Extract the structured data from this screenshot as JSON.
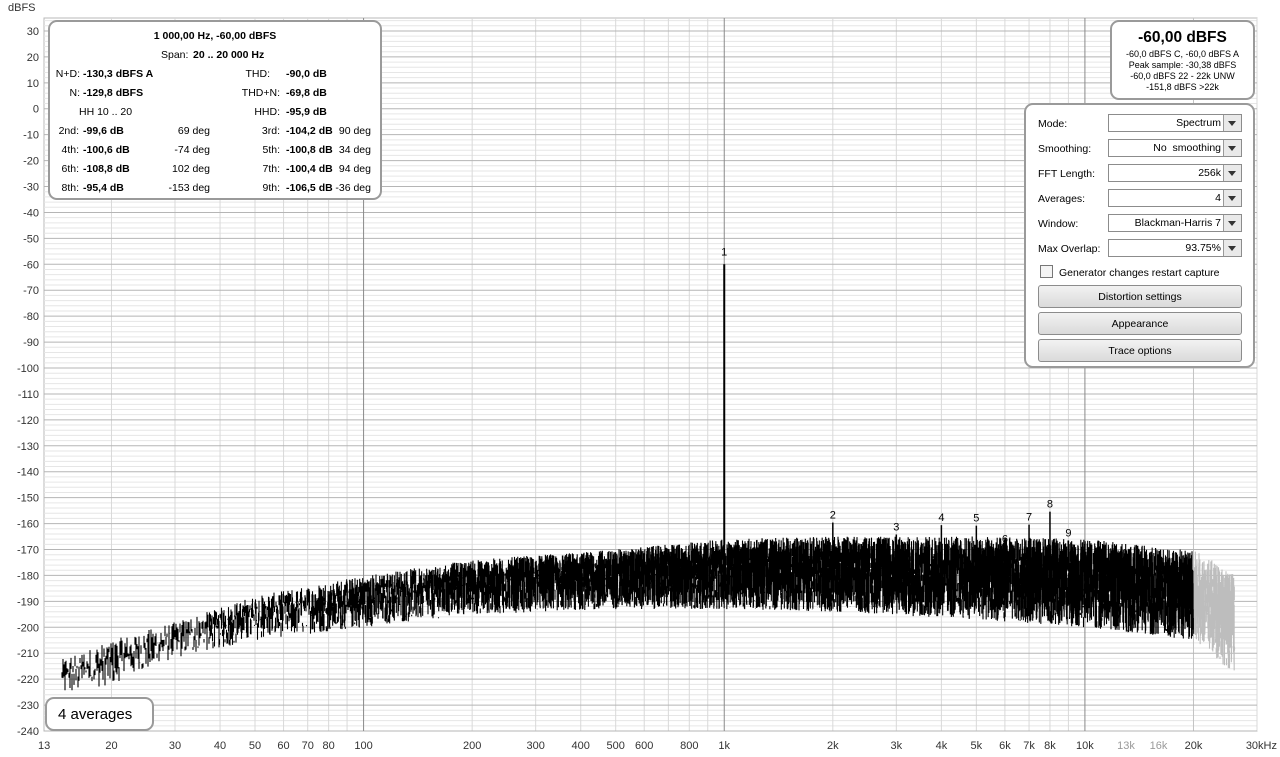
{
  "y_unit": "dBFS",
  "y_ticks": [
    "30",
    "20",
    "10",
    "0",
    "-10",
    "-20",
    "-30",
    "-40",
    "-50",
    "-60",
    "-70",
    "-80",
    "-90",
    "-100",
    "-110",
    "-120",
    "-130",
    "-140",
    "-150",
    "-160",
    "-170",
    "-180",
    "-190",
    "-200",
    "-210",
    "-220",
    "-230",
    "-240"
  ],
  "x_ticks": [
    {
      "f": 13,
      "label": "13",
      "light": false
    },
    {
      "f": 20,
      "label": "20",
      "light": false
    },
    {
      "f": 30,
      "label": "30",
      "light": false
    },
    {
      "f": 40,
      "label": "40",
      "light": false
    },
    {
      "f": 50,
      "label": "50",
      "light": false
    },
    {
      "f": 60,
      "label": "60",
      "light": false
    },
    {
      "f": 70,
      "label": "70",
      "light": false
    },
    {
      "f": 80,
      "label": "80",
      "light": false
    },
    {
      "f": 100,
      "label": "100",
      "light": false
    },
    {
      "f": 200,
      "label": "200",
      "light": false
    },
    {
      "f": 300,
      "label": "300",
      "light": false
    },
    {
      "f": 400,
      "label": "400",
      "light": false
    },
    {
      "f": 500,
      "label": "500",
      "light": false
    },
    {
      "f": 600,
      "label": "600",
      "light": false
    },
    {
      "f": 800,
      "label": "800",
      "light": false
    },
    {
      "f": 1000,
      "label": "1k",
      "light": false
    },
    {
      "f": 2000,
      "label": "2k",
      "light": false
    },
    {
      "f": 3000,
      "label": "3k",
      "light": false
    },
    {
      "f": 4000,
      "label": "4k",
      "light": false
    },
    {
      "f": 5000,
      "label": "5k",
      "light": false
    },
    {
      "f": 6000,
      "label": "6k",
      "light": false
    },
    {
      "f": 7000,
      "label": "7k",
      "light": false
    },
    {
      "f": 8000,
      "label": "8k",
      "light": false
    },
    {
      "f": 10000,
      "label": "10k",
      "light": false
    },
    {
      "f": 13000,
      "label": "13k",
      "light": true
    },
    {
      "f": 16000,
      "label": "16k",
      "light": true
    },
    {
      "f": 20000,
      "label": "20k",
      "light": false
    },
    {
      "f": 30000,
      "label": "30kHz",
      "light": false
    }
  ],
  "chart_data": {
    "type": "line",
    "ylabel": "dBFS",
    "xlabel": "kHz",
    "x_scale": "log",
    "xlim": [
      13,
      30000
    ],
    "ylim": [
      -240,
      35
    ],
    "grid": true,
    "fundamental": {
      "label": "1",
      "freq_hz": 1000,
      "level_dbfs": -60
    },
    "harmonics": [
      {
        "label": "2",
        "freq_hz": 2000,
        "level_dbfs": -159.6
      },
      {
        "label": "3",
        "freq_hz": 3000,
        "level_dbfs": -164.2
      },
      {
        "label": "4",
        "freq_hz": 4000,
        "level_dbfs": -160.6
      },
      {
        "label": "5",
        "freq_hz": 5000,
        "level_dbfs": -160.8
      },
      {
        "label": "6",
        "freq_hz": 6000,
        "level_dbfs": -168.8
      },
      {
        "label": "7",
        "freq_hz": 7000,
        "level_dbfs": -160.4
      },
      {
        "label": "8",
        "freq_hz": 8000,
        "level_dbfs": -155.4
      },
      {
        "label": "9",
        "freq_hz": 9000,
        "level_dbfs": -166.5
      }
    ],
    "noise_floor_envelope": [
      {
        "freq_hz": 13,
        "top": -215,
        "bottom": -228
      },
      {
        "freq_hz": 20,
        "top": -205,
        "bottom": -222
      },
      {
        "freq_hz": 30,
        "top": -198,
        "bottom": -212
      },
      {
        "freq_hz": 50,
        "top": -188,
        "bottom": -205
      },
      {
        "freq_hz": 100,
        "top": -180,
        "bottom": -200
      },
      {
        "freq_hz": 200,
        "top": -174,
        "bottom": -195
      },
      {
        "freq_hz": 500,
        "top": -170,
        "bottom": -193
      },
      {
        "freq_hz": 1000,
        "top": -166,
        "bottom": -193
      },
      {
        "freq_hz": 2000,
        "top": -165,
        "bottom": -194
      },
      {
        "freq_hz": 5000,
        "top": -165,
        "bottom": -197
      },
      {
        "freq_hz": 10000,
        "top": -166,
        "bottom": -200
      },
      {
        "freq_hz": 20000,
        "top": -170,
        "bottom": -205
      }
    ],
    "out_of_band_envelope": [
      {
        "freq_hz": 20000,
        "top": -170,
        "bottom": -205
      },
      {
        "freq_hz": 23000,
        "top": -175,
        "bottom": -212
      },
      {
        "freq_hz": 26000,
        "top": -180,
        "bottom": -218
      }
    ],
    "trace_color": "#000000",
    "out_of_band_color": "#bdbdbd"
  },
  "distortion": {
    "title": "1 000,00 Hz, -60,00 dBFS",
    "span_label": "Span:",
    "span_value": "20 .. 20 000 Hz",
    "nd_label": "N+D:",
    "nd_value": "-130,3 dBFS A",
    "thd_label": "THD:",
    "thd_value": "-90,0 dB",
    "n_label": "N:",
    "n_value": "-129,8 dBFS",
    "thdn_label": "THD+N:",
    "thdn_value": "-69,8 dB",
    "hh_label": "HH 10 .. 20",
    "hhd_label": "HHD:",
    "hhd_value": "-95,9 dB",
    "harmonics": [
      {
        "label": "2nd:",
        "value": "-99,6 dB",
        "phase": "69 deg"
      },
      {
        "label": "3rd:",
        "value": "-104,2 dB",
        "phase": "90 deg"
      },
      {
        "label": "4th:",
        "value": "-100,6 dB",
        "phase": "-74 deg"
      },
      {
        "label": "5th:",
        "value": "-100,8 dB",
        "phase": "34 deg"
      },
      {
        "label": "6th:",
        "value": "-108,8 dB",
        "phase": "102 deg"
      },
      {
        "label": "7th:",
        "value": "-100,4 dB",
        "phase": "94 deg"
      },
      {
        "label": "8th:",
        "value": "-95,4 dB",
        "phase": "-153 deg"
      },
      {
        "label": "9th:",
        "value": "-106,5 dB",
        "phase": "-36 deg"
      }
    ]
  },
  "level": {
    "main": "-60,00 dBFS",
    "lines": [
      "-60,0 dBFS C, -60,0 dBFS A",
      "Peak sample: -30,38 dBFS",
      "-60,0 dBFS 22 - 22k UNW",
      "-151,8 dBFS >22k"
    ]
  },
  "controls": {
    "mode": {
      "label": "Mode:",
      "value": "Spectrum"
    },
    "smoothing": {
      "label": "Smoothing:",
      "value": "No  smoothing"
    },
    "fft": {
      "label": "FFT Length:",
      "value": "256k"
    },
    "averages": {
      "label": "Averages:",
      "value": "4"
    },
    "window": {
      "label": "Window:",
      "value": "Blackman-Harris 7"
    },
    "overlap": {
      "label": "Max Overlap:",
      "value": "93.75%"
    },
    "generator_restart": {
      "label": "Generator changes restart capture",
      "checked": false
    },
    "distortion_button": "Distortion settings",
    "appearance_button": "Appearance",
    "trace_button": "Trace options"
  },
  "averages_badge": "4 averages"
}
